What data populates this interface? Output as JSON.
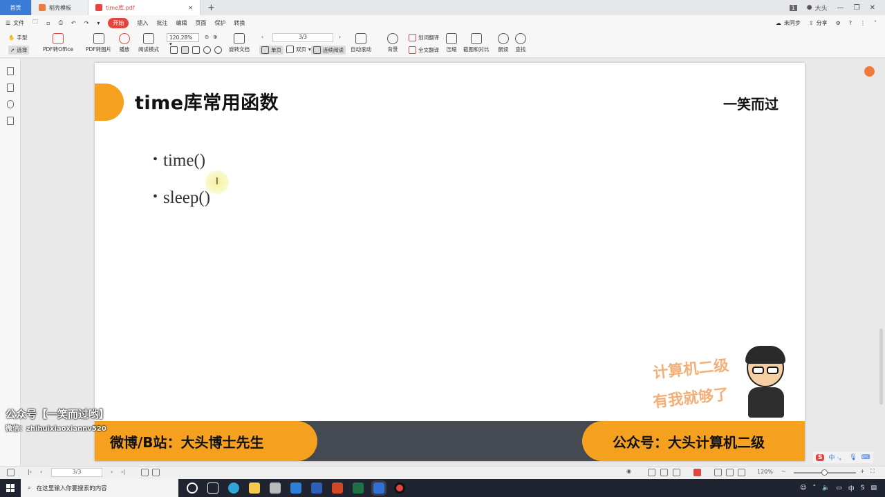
{
  "tabs": {
    "home": "首页",
    "t1": "稻壳模板",
    "t2": "time库.pdf",
    "new": "+"
  },
  "window": {
    "user": "大头",
    "badge": "1"
  },
  "menu": {
    "file": "文件",
    "items": [
      "开始",
      "插入",
      "批注",
      "编辑",
      "页面",
      "保护",
      "转换"
    ],
    "right": [
      "未同步",
      "分享"
    ]
  },
  "ribbon": {
    "hand": "手型",
    "select": "选择",
    "pdf_to_office": "PDF转Office",
    "pdf_to_image": "PDF转图片",
    "play": "播放",
    "read_mode": "阅读模式",
    "zoom": "120.28%",
    "rotate": "旋转文档",
    "page_indicator": "3/3",
    "single": "单页",
    "double": "双页",
    "continuous": "连续阅读",
    "auto_scroll": "自动滚动",
    "background": "背景",
    "word_translate": "划词翻译",
    "full_translate": "全文翻译",
    "compress": "压缩",
    "screenshot_compare": "截图和对比",
    "read_aloud": "朗读",
    "find": "查找"
  },
  "slide": {
    "title": "time库常用函数",
    "brand": "一笑而过",
    "bullets": [
      "time()",
      "sleep()"
    ],
    "sticker_line1": "计算机二级",
    "sticker_line2": "有我就够了",
    "footer_left": "微博/B站：大头博士先生",
    "footer_right": "公众号：大头计算机二级"
  },
  "watermark": {
    "line1": "公众号【一笑而过哟】",
    "line2": "微信：zhihuixiaoxiannv520"
  },
  "ime": {
    "logo": "S",
    "text": "中 ·。"
  },
  "status": {
    "page": "3/3",
    "zoom": "120%"
  },
  "taskbar": {
    "search_placeholder": "在这里输入你要搜索的内容",
    "time": ""
  },
  "colors": {
    "accent_orange": "#f5a11f",
    "band_dark": "#454952",
    "start_red": "#e4453c"
  }
}
